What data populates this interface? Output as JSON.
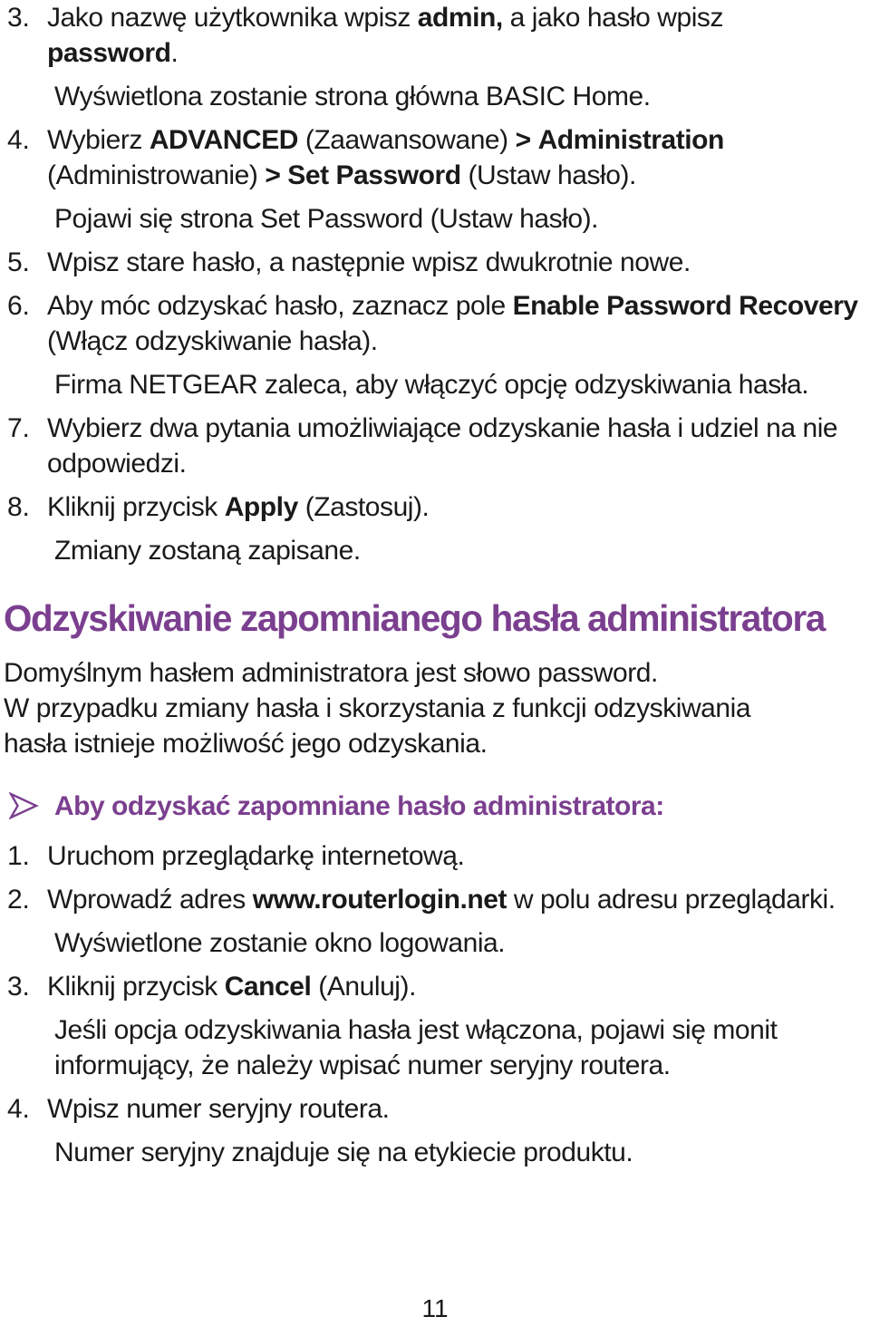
{
  "document": {
    "language": "pl",
    "page_number": "11",
    "accent_color": "#7b3f8f",
    "text_color": "#1a1a1a",
    "background_color": "#ffffff"
  },
  "steps_top": [
    {
      "number": "3.",
      "segments": [
        {
          "text": "Jako nazwę użytkownika wpisz ",
          "bold": false
        },
        {
          "text": "admin,",
          "bold": true
        },
        {
          "text": " a jako hasło wpisz ",
          "bold": false
        },
        {
          "text": "password",
          "bold": true
        },
        {
          "text": ".",
          "bold": false
        }
      ],
      "note": "Wyświetlona zostanie strona główna BASIC Home."
    },
    {
      "number": "4.",
      "segments": [
        {
          "text": "Wybierz ",
          "bold": false
        },
        {
          "text": "ADVANCED",
          "bold": true
        },
        {
          "text": " (Zaawansowane) ",
          "bold": false
        },
        {
          "text": ">",
          "bold": true
        },
        {
          "text": " ",
          "bold": false
        },
        {
          "text": "Administration",
          "bold": true
        },
        {
          "text": " (Administrowanie) ",
          "bold": false
        },
        {
          "text": ">",
          "bold": true
        },
        {
          "text": " ",
          "bold": false
        },
        {
          "text": "Set Password",
          "bold": true
        },
        {
          "text": " (Ustaw hasło).",
          "bold": false
        }
      ],
      "note": "Pojawi się strona Set Password (Ustaw hasło)."
    },
    {
      "number": "5.",
      "segments": [
        {
          "text": "Wpisz stare hasło, a następnie wpisz dwukrotnie nowe.",
          "bold": false
        }
      ],
      "note": ""
    },
    {
      "number": "6.",
      "segments": [
        {
          "text": "Aby móc odzyskać hasło, zaznacz pole ",
          "bold": false
        },
        {
          "text": "Enable Password Recovery",
          "bold": true
        },
        {
          "text": " (Włącz odzyskiwanie hasła).",
          "bold": false
        }
      ],
      "note": "Firma NETGEAR zaleca, aby włączyć opcję odzyskiwania hasła."
    },
    {
      "number": "7.",
      "segments": [
        {
          "text": "Wybierz dwa pytania umożliwiające odzyskanie hasła i udziel na nie odpowiedzi.",
          "bold": false
        }
      ],
      "note": ""
    },
    {
      "number": "8.",
      "segments": [
        {
          "text": "Kliknij przycisk ",
          "bold": false
        },
        {
          "text": "Apply",
          "bold": true
        },
        {
          "text": " (Zastosuj).",
          "bold": false
        }
      ],
      "note": "Zmiany zostaną zapisane."
    }
  ],
  "section": {
    "heading": "Odzyskiwanie zapomnianego hasła administratora",
    "intro_line_1": "Domyślnym hasłem administratora jest słowo password.",
    "intro_line_2": "W przypadku zmiany hasła i skorzystania z funkcji odzyskiwania",
    "intro_line_3": "hasła istnieje możliwość jego odzyskania.",
    "procedure_heading": "Aby odzyskać zapomniane hasło administratora:",
    "arrow_bullet_icon": "arrow-bullet-icon"
  },
  "steps_bottom": [
    {
      "number": "1.",
      "segments": [
        {
          "text": "Uruchom przeglądarkę internetową.",
          "bold": false
        }
      ],
      "note": ""
    },
    {
      "number": "2.",
      "segments": [
        {
          "text": "Wprowadź adres ",
          "bold": false
        },
        {
          "text": "www.routerlogin.net",
          "bold": true
        },
        {
          "text": " w polu adresu przeglądarki.",
          "bold": false
        }
      ],
      "note": "Wyświetlone zostanie okno logowania."
    },
    {
      "number": "3.",
      "segments": [
        {
          "text": "Kliknij przycisk ",
          "bold": false
        },
        {
          "text": "Cancel",
          "bold": true
        },
        {
          "text": " (Anuluj).",
          "bold": false
        }
      ],
      "note": "Jeśli opcja odzyskiwania hasła jest włączona, pojawi się monit informujący, że należy wpisać numer seryjny routera."
    },
    {
      "number": "4.",
      "segments": [
        {
          "text": "Wpisz numer seryjny routera.",
          "bold": false
        }
      ],
      "note": "Numer seryjny znajduje się na etykiecie produktu."
    }
  ]
}
